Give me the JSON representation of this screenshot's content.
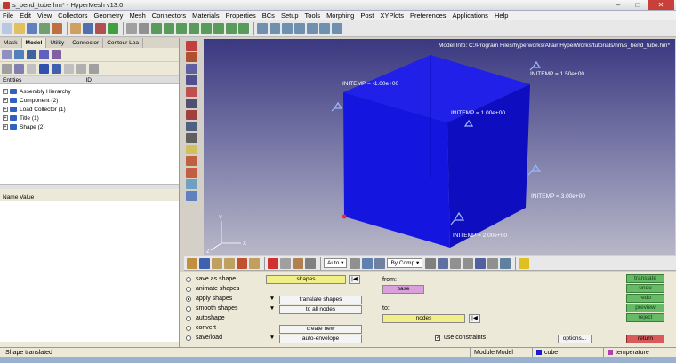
{
  "window": {
    "title": "s_bend_tube.hm* - HyperMesh v13.0"
  },
  "menu": [
    "File",
    "Edit",
    "View",
    "Collectors",
    "Geometry",
    "Mesh",
    "Connectors",
    "Materials",
    "Properties",
    "BCs",
    "Setup",
    "Tools",
    "Morphing",
    "Post",
    "XYPlots",
    "Preferences",
    "Applications",
    "Help"
  ],
  "left": {
    "tabs": [
      "Mask",
      "Model",
      "Utility",
      "Connector",
      "Contour Loa"
    ],
    "entities_label": "Entities",
    "id_label": "ID",
    "tree": [
      "Assembly Hierarchy",
      "Component (2)",
      "Load Collector (1)",
      "Title (1)",
      "Shape (2)"
    ],
    "name_value_header": "Name Value"
  },
  "viewport": {
    "model_info": "Model Info: C:/Program Files/hyperworks/Altair HyperWorks/tutorials/hm/s_bend_tube.hm*",
    "labels": [
      "INITEMP = -1.00e+00",
      "INITEMP = 1.00e+00",
      "INITEMP = 1.50e+00",
      "INITEMP = 3.00e+00",
      "INITEMP = 2.00e+00"
    ]
  },
  "bottom_toolbar": {
    "view_mode": "Auto",
    "color_mode": "By Comp"
  },
  "panel": {
    "options": [
      "save as shape",
      "animate shapes",
      "apply shapes",
      "smooth shapes",
      "autoshape",
      "convert",
      "save/load"
    ],
    "selected_option": "apply shapes",
    "shapes_button": "shapes",
    "translate_shapes": "translate shapes",
    "to_all_nodes": "to all nodes",
    "create_new": "create new",
    "auto_envelope": "auto-envelope",
    "from_label": "from:",
    "from_value": "base",
    "to_label": "to:",
    "to_value": "nodes",
    "use_constraints": "use constraints",
    "options_button": "options...",
    "right_buttons": [
      "translate",
      "undo",
      "redo",
      "preview",
      "reject"
    ],
    "return_button": "return"
  },
  "status": {
    "message": "Shape translated",
    "module": "Module Model",
    "component": "cube",
    "loadcol": "temperature"
  },
  "colors": {
    "cube": "#1515e0",
    "component_swatch": "#1a1ad0",
    "loadcol_swatch": "#b040b0"
  }
}
